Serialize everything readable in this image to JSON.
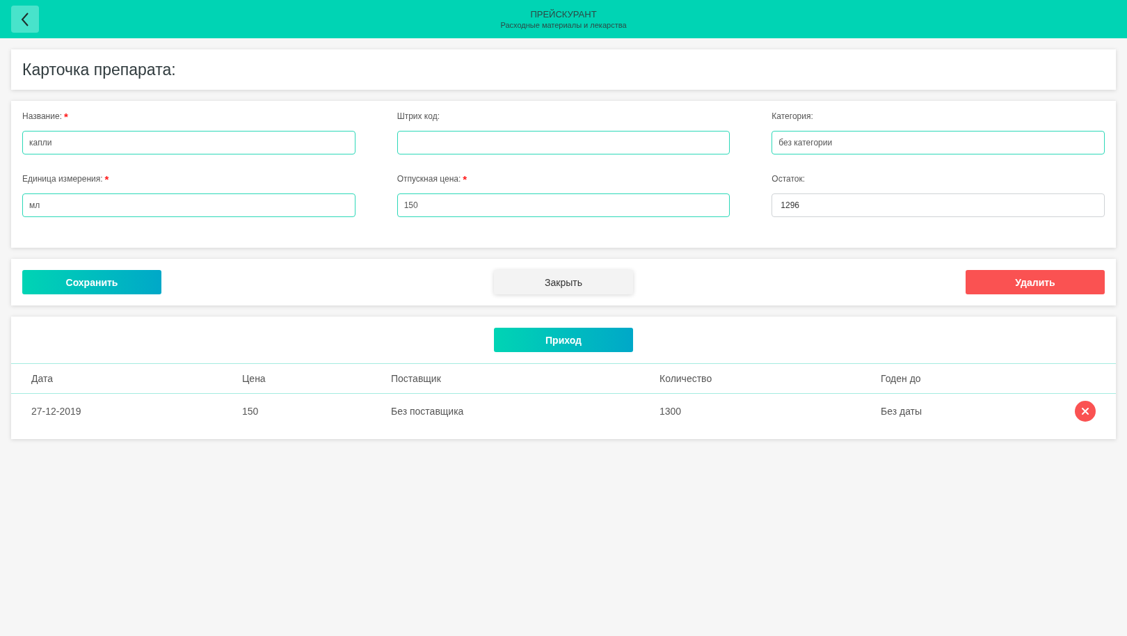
{
  "header": {
    "title": "ПРЕЙСКУРАНТ",
    "subtitle": "Расходные материалы и лекарства"
  },
  "card_title": "Карточка препарата:",
  "form": {
    "fields": [
      {
        "label": "Название:",
        "required_mark": "*",
        "value": "капли",
        "disabled": false
      },
      {
        "label": "Штрих код:",
        "disabled": false
      },
      {
        "label": "Категория:",
        "value": "без категории",
        "disabled": false
      },
      {
        "label": "Единица измерения:",
        "required_mark": "*",
        "value": "мл",
        "disabled": false
      },
      {
        "label": "Отпускная цена:",
        "required_mark": "*",
        "value": "150",
        "disabled": false
      },
      {
        "label": "Остаток:",
        "value": "1296",
        "disabled": true
      }
    ]
  },
  "actions": [
    {
      "kind": "primary",
      "label": "Сохранить"
    },
    {
      "kind": "secondary",
      "label": "Закрыть"
    },
    {
      "kind": "danger",
      "label": "Удалить"
    }
  ],
  "receipts": {
    "add_button": "Приход",
    "table": {
      "columns": [
        "Дата",
        "Цена",
        "Поставщик",
        "Количество",
        "Годен до"
      ],
      "rows": [
        {
          "cells": [
            "27-12-2019",
            "150",
            "Без поставщика",
            "1300",
            "Без даты"
          ]
        }
      ]
    }
  }
}
